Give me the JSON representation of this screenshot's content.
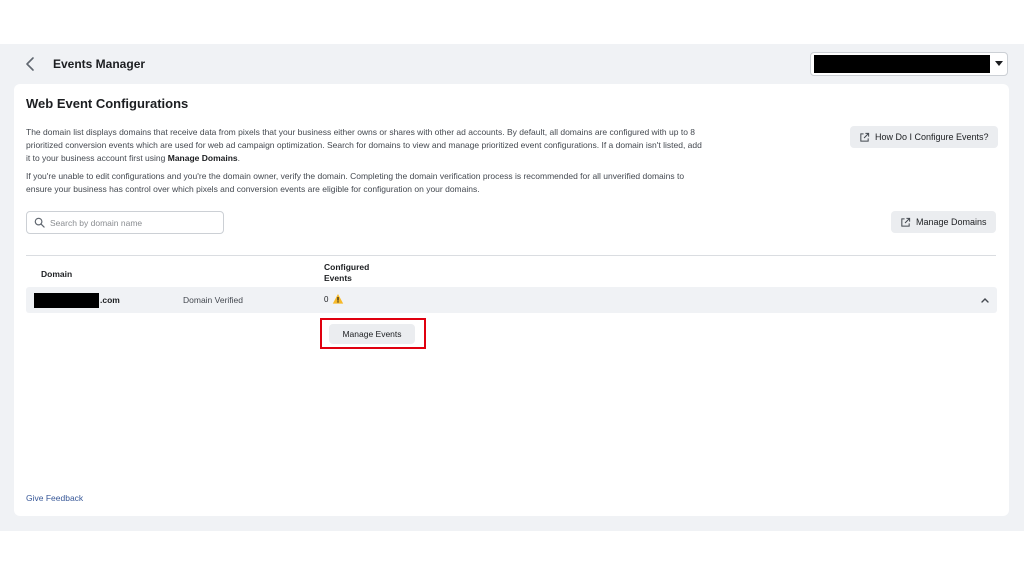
{
  "header": {
    "title": "Events Manager",
    "back_icon": "chevron-left-icon",
    "account_selector": {
      "value_redacted": true,
      "caret_icon": "caret-down-icon"
    }
  },
  "page": {
    "title": "Web Event Configurations",
    "description_1_a": "The domain list displays domains that receive data from pixels that your business either owns or shares with other ad accounts. By default, all domains are configured with up to 8 prioritized conversion events which are used for web ad campaign optimization. Search for domains to view and manage prioritized event configurations. If a domain isn't listed, add it to your business account first using ",
    "description_1_link": "Manage Domains",
    "description_1_end": ".",
    "description_2": "If you're unable to edit configurations and you're the domain owner, verify the domain. Completing the domain verification process is recommended for all unverified domains to ensure your business has control over which pixels and conversion events are eligible for configuration on your domains.",
    "howto_button": "How Do I Configure Events?",
    "manage_domains_button": "Manage Domains",
    "external_link_icon": "external-link-icon"
  },
  "search": {
    "placeholder": "Search by domain name",
    "icon": "search-icon"
  },
  "table": {
    "columns": [
      "Domain",
      "Configured Events"
    ],
    "rows": [
      {
        "domain_suffix": ".com",
        "status": "Domain Verified",
        "configured_events": "0",
        "warning_icon": "warning-icon",
        "expand_icon": "chevron-up-icon"
      }
    ]
  },
  "actions": {
    "manage_events": "Manage Events"
  },
  "footer": {
    "feedback_link": "Give Feedback"
  },
  "colors": {
    "highlight_border": "#e0000f",
    "link": "#385898",
    "warning": "#f7b928",
    "background": "#f0f2f5"
  }
}
